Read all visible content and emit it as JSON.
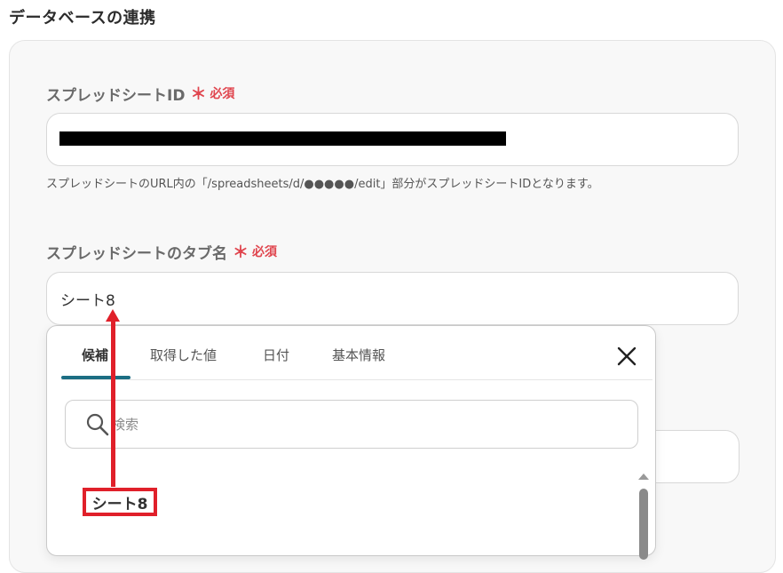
{
  "section": {
    "title": "データベースの連携"
  },
  "spreadsheet_id": {
    "label": "スプレッドシートID",
    "required_mark": "＊",
    "required_text": "必須",
    "help": "スプレッドシートのURL内の「/spreadsheets/d/●●●●●/edit」部分がスプレッドシートIDとなります。"
  },
  "tab_name": {
    "label": "スプレッドシートのタブ名",
    "required_mark": "＊",
    "required_text": "必須",
    "value": "シート8"
  },
  "popup": {
    "tabs": [
      "候補",
      "取得した値",
      "日付",
      "基本情報"
    ],
    "active_tab": "候補",
    "search_placeholder": "検索",
    "items": [
      "シート8"
    ]
  },
  "annotation": {
    "color": "#e0202a"
  },
  "colors": {
    "accent": "#1c6e83",
    "required": "#e0454e"
  }
}
